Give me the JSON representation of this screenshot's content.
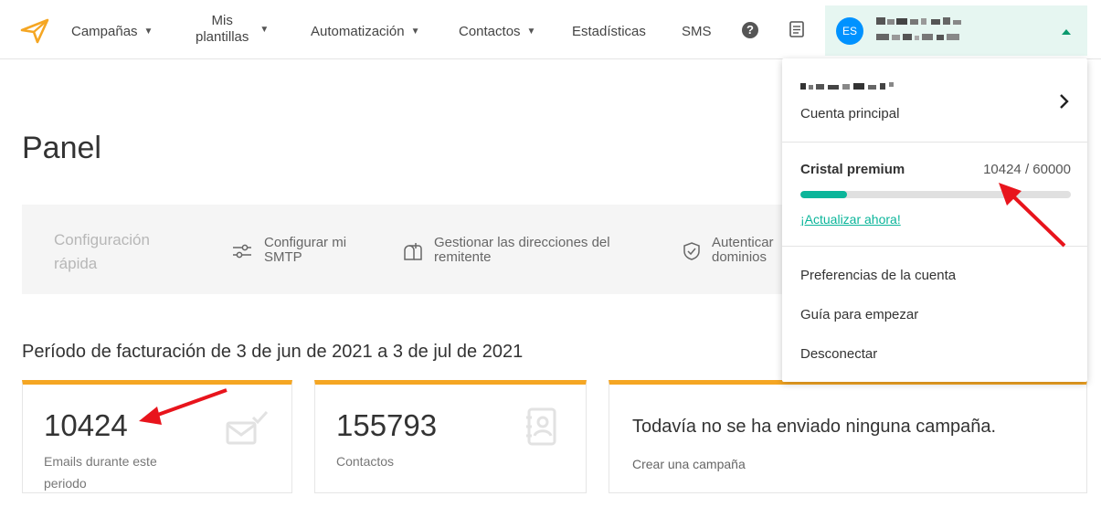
{
  "nav": {
    "campaigns": "Campañas",
    "templates_line1": "Mis",
    "templates_line2": "plantillas",
    "automation": "Automatización",
    "contacts": "Contactos",
    "stats": "Estadísticas",
    "sms": "SMS",
    "help": "?"
  },
  "account": {
    "initials": "ES"
  },
  "dropdown": {
    "account_type": "Cuenta principal",
    "plan_name": "Cristal premium",
    "plan_usage": "10424 / 60000",
    "plan_usage_fraction": 0.1737,
    "upgrade": "¡Actualizar ahora!",
    "preferences": "Preferencias de la cuenta",
    "guide": "Guía para empezar",
    "logout": "Desconectar"
  },
  "page": {
    "title": "Panel"
  },
  "quick_setup": {
    "label": "Configuración rápida",
    "smtp_line1": "Configurar mi",
    "smtp_line2": "SMTP",
    "senders_line1": "Gestionar las direcciones del",
    "senders_line2": "remitente",
    "domains_line1": "Autenticar",
    "domains_line2": "dominios"
  },
  "billing": {
    "period": "Período de facturación de 3 de jun de 2021 a 3 de jul de 2021"
  },
  "cards": {
    "emails_value": "10424",
    "emails_label": "Emails durante este periodo",
    "contacts_value": "155793",
    "contacts_label": "Contactos",
    "campaign_message": "Todavía no se ha enviado ninguna campaña.",
    "campaign_link": "Crear una campaña"
  },
  "colors": {
    "accent_orange": "#f5a623",
    "accent_green": "#0bb59a",
    "avatar_blue": "#0092ff",
    "arrow_red": "#e8141c"
  }
}
